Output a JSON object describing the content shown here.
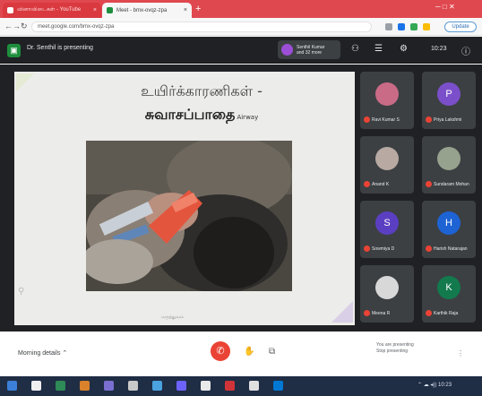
{
  "browser": {
    "tabs": [
      {
        "label": "வினாவிடைகள் - YouTube",
        "favicon_color": "#ffffff"
      },
      {
        "label": "Meet - bmx-ovqz-zpa",
        "favicon_color": "#1e8e3e"
      }
    ],
    "new_tab_glyph": "+",
    "window_controls": "─ □ ✕",
    "url": "meet.google.com/bmx-ovqz-zpa",
    "update_label": "Update"
  },
  "meet": {
    "presenting_label": "Dr. Senthil is presenting",
    "presenter_chip": {
      "line1": "Senthil Kumar",
      "line2": "and 32 more"
    },
    "participant_count": "33",
    "clock": "10:23",
    "meeting_name": "Morning details",
    "presenting_note": {
      "line1": "You are presenting",
      "line2": "Stop presenting"
    }
  },
  "slide": {
    "title_line1": "உயிர்க்காரணிகள் -",
    "title_line2": "சுவாசப்பாதை",
    "title_english": "Airway",
    "footer": "மருத்துவம்"
  },
  "participants": [
    {
      "name": "Ravi Kumar S",
      "initial": "",
      "color": "#c96a86"
    },
    {
      "name": "Priya Lakshmi",
      "initial": "P",
      "color": "#7b4fc9"
    },
    {
      "name": "Anand K",
      "initial": "",
      "color": "#b8a9a3"
    },
    {
      "name": "Sundaram Mohan",
      "initial": "",
      "color": "#97a28e"
    },
    {
      "name": "Sowmiya D",
      "initial": "S",
      "color": "#5b3fc2"
    },
    {
      "name": "Harish Natarajan",
      "initial": "H",
      "color": "#1e63d4"
    },
    {
      "name": "Meena R",
      "initial": "",
      "color": "#d8d8d8"
    },
    {
      "name": "Karthik Raja",
      "initial": "K",
      "color": "#137a4e"
    }
  ],
  "controls": {
    "end_call_glyph": "✆",
    "raise_hand_glyph": "✋",
    "captions_glyph": "⧉",
    "more_glyph": "⋮"
  },
  "colors": {
    "browser_accent": "#e0484f",
    "meet_dark": "#202124",
    "end_call": "#ea4335",
    "taskbar": "#1f2d45"
  },
  "icons": [
    "back-icon",
    "forward-icon",
    "reload-icon",
    "people-icon",
    "chat-icon",
    "activities-icon",
    "info-icon"
  ]
}
